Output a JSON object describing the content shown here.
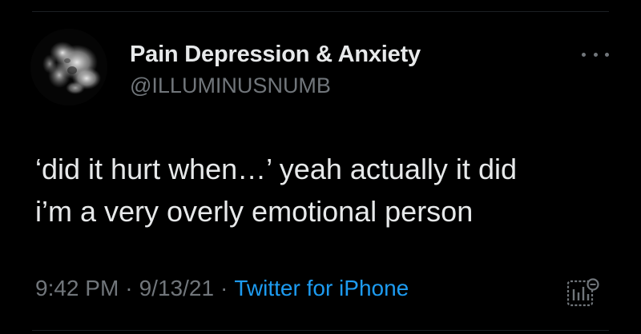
{
  "user": {
    "display_name": "Pain Depression & Anxiety",
    "handle": "@ILLUMINUSNUMB",
    "avatar_icon": "smoke-avatar-icon"
  },
  "tweet": {
    "lines": [
      "‘did it hurt when…’ yeah actually it did",
      "i’m a very overly emotional person"
    ]
  },
  "meta": {
    "time": "9:42 PM",
    "date": "9/13/21",
    "source": "Twitter for iPhone",
    "separator": "·"
  },
  "icons": {
    "more": "more-options-icon",
    "analytics": "analytics-icon"
  },
  "colors": {
    "background": "#000000",
    "primary_text": "#e7e9ea",
    "secondary_text": "#71767b",
    "accent": "#1d9bf0"
  }
}
